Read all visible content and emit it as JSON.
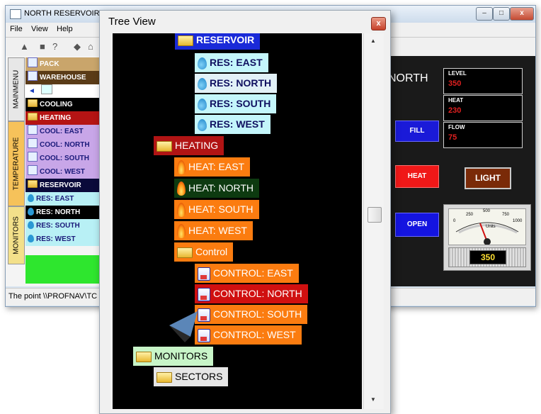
{
  "back_window": {
    "title": "NORTH RESERVOIR",
    "menu": [
      "File",
      "View",
      "Help"
    ],
    "status": "The point \\\\PROFNAV\\TC",
    "left_tabs": [
      "MAINMENU",
      "TEMPERATURE",
      "MONITORS"
    ],
    "left_rows": [
      {
        "label": "PACK",
        "bg": "#c9a56b",
        "fg": "#ffffff",
        "icon": "user-icon"
      },
      {
        "label": "WAREHOUSE",
        "bg": "#5a3b17",
        "fg": "#ffffff",
        "icon": "user-icon"
      },
      {
        "label": "",
        "bg": "#ffffff",
        "fg": "#000000",
        "icon": "nav"
      },
      {
        "label": "COOLING",
        "bg": "#000000",
        "fg": "#ffffff",
        "icon": "folder-icon"
      },
      {
        "label": "HEATING",
        "bg": "#b51414",
        "fg": "#ffffff",
        "icon": "folder-icon"
      },
      {
        "label": "COOL: EAST",
        "bg": "#c8a6e8",
        "fg": "#1a1a7a",
        "icon": "user-icon"
      },
      {
        "label": "COOL: NORTH",
        "bg": "#c8a6e8",
        "fg": "#1a1a7a",
        "icon": "user-icon"
      },
      {
        "label": "COOL: SOUTH",
        "bg": "#c8a6e8",
        "fg": "#1a1a7a",
        "icon": "user-icon"
      },
      {
        "label": "COOL: WEST",
        "bg": "#c8a6e8",
        "fg": "#1a1a7a",
        "icon": "user-icon"
      },
      {
        "label": "RESERVOIR",
        "bg": "#0a0a3a",
        "fg": "#ffffff",
        "icon": "folder-icon"
      },
      {
        "label": "RES: EAST",
        "bg": "#b8f0f5",
        "fg": "#1a1a7a",
        "icon": "drop-icon"
      },
      {
        "label": "RES: NORTH",
        "bg": "#000000",
        "fg": "#ffffff",
        "icon": "drop-icon"
      },
      {
        "label": "RES: SOUTH",
        "bg": "#b8f0f5",
        "fg": "#1a1a7a",
        "icon": "drop-icon"
      },
      {
        "label": "RES: WEST",
        "bg": "#b8f0f5",
        "fg": "#1a1a7a",
        "icon": "drop-icon"
      }
    ],
    "dashboard": {
      "north_label": "NORTH",
      "level_key": "LEVEL",
      "level_val": "350",
      "heat_key": "HEAT",
      "heat_val": "230",
      "flow_key": "FLOW",
      "flow_val": "75",
      "fill_label": "FILL",
      "heat_label": "HEAT",
      "open_label": "OPEN",
      "light_label": "LIGHT",
      "gauge_ticks": [
        "0",
        "250",
        "500",
        "750",
        "1000"
      ],
      "gauge_units": "Units",
      "gauge_readout": "350"
    }
  },
  "tree_view": {
    "title": "Tree View",
    "nodes": [
      {
        "label": "RESERVOIR",
        "icon": "folder-icon",
        "bg": "#1a2ad8",
        "fg": "#ffffff",
        "bold": true
      },
      {
        "label": "RES: EAST",
        "icon": "drop-icon",
        "bg": "#c4f6fb",
        "fg": "#101060",
        "bold": true
      },
      {
        "label": "RES: NORTH",
        "icon": "drop-icon",
        "bg": "#e2f1f7",
        "fg": "#101060",
        "bold": true
      },
      {
        "label": "RES: SOUTH",
        "icon": "drop-icon",
        "bg": "#c4f6fb",
        "fg": "#101060",
        "bold": true
      },
      {
        "label": "RES: WEST",
        "icon": "drop-icon",
        "bg": "#c4f6fb",
        "fg": "#101060",
        "bold": true
      },
      {
        "label": "HEATING",
        "icon": "folder-icon",
        "bg": "#b11414",
        "fg": "#ffffff",
        "bold": false
      },
      {
        "label": "HEAT: EAST",
        "icon": "flame-icon",
        "bg": "#fb7c10",
        "fg": "#ffffff",
        "bold": false
      },
      {
        "label": "HEAT: NORTH",
        "icon": "flame-icon",
        "bg": "#0d3a10",
        "fg": "#ffffff",
        "bold": false
      },
      {
        "label": "HEAT: SOUTH",
        "icon": "flame-icon",
        "bg": "#fb7c10",
        "fg": "#ffffff",
        "bold": false
      },
      {
        "label": "HEAT: WEST",
        "icon": "flame-icon",
        "bg": "#fb7c10",
        "fg": "#ffffff",
        "bold": false
      },
      {
        "label": "Control",
        "icon": "folder-icon",
        "bg": "#fb7c10",
        "fg": "#ffffff",
        "bold": false
      },
      {
        "label": "CONTROL: EAST",
        "icon": "flask-icon",
        "bg": "#fb7c10",
        "fg": "#ffffff",
        "bold": false
      },
      {
        "label": "CONTROL: NORTH",
        "icon": "flask-icon",
        "bg": "#d01010",
        "fg": "#ffffff",
        "bold": false
      },
      {
        "label": "CONTROL: SOUTH",
        "icon": "flask-icon",
        "bg": "#fb7c10",
        "fg": "#ffffff",
        "bold": false
      },
      {
        "label": "CONTROL: WEST",
        "icon": "flask-icon",
        "bg": "#fb7c10",
        "fg": "#ffffff",
        "bold": false
      },
      {
        "label": "MONITORS",
        "icon": "folder-icon",
        "bg": "#c8f5c8",
        "fg": "#000000",
        "bold": false
      },
      {
        "label": "SECTORS",
        "icon": "folder-icon",
        "bg": "#e6e6e6",
        "fg": "#000000",
        "bold": false
      }
    ]
  }
}
